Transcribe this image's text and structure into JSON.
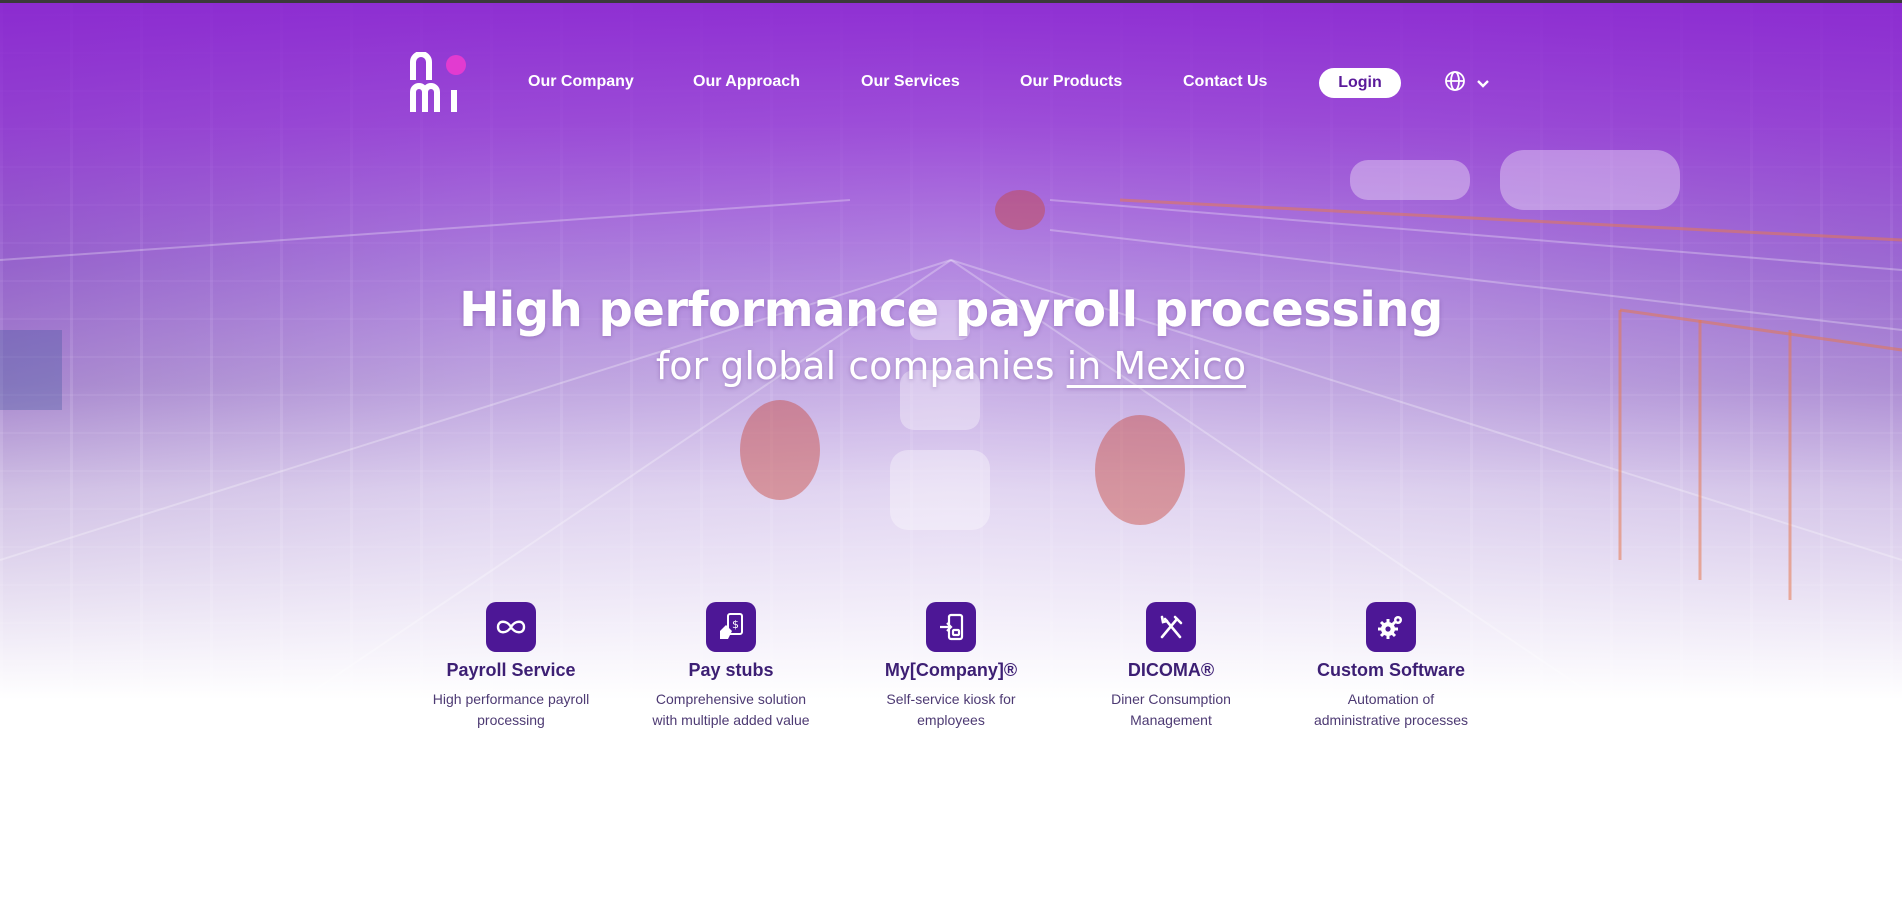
{
  "brand": {
    "logo_text": "nomi",
    "accent": "#e23bd0",
    "primary": "#4d1796"
  },
  "nav": {
    "items": [
      {
        "label": "Our Company"
      },
      {
        "label": "Our Approach"
      },
      {
        "label": "Our Services"
      },
      {
        "label": "Our Products"
      },
      {
        "label": "Contact Us"
      }
    ],
    "login_label": "Login",
    "language_icon": "globe-icon"
  },
  "hero": {
    "title": "High performance payroll processing",
    "subtitle_prefix": "for global companies ",
    "subtitle_highlight": "in Mexico"
  },
  "services": [
    {
      "icon": "infinity-icon",
      "title": "Payroll Service",
      "desc_line1": "High performance payroll",
      "desc_line2": "processing"
    },
    {
      "icon": "paystub-icon",
      "title": "Pay stubs",
      "desc_line1": "Comprehensive solution",
      "desc_line2": "with multiple added value"
    },
    {
      "icon": "kiosk-icon",
      "title": "My[Company]®",
      "desc_line1": "Self-service kiosk for",
      "desc_line2": "employees"
    },
    {
      "icon": "fork-knife-icon",
      "title": "DICOMA®",
      "desc_line1": "Diner Consumption",
      "desc_line2": "Management"
    },
    {
      "icon": "gears-icon",
      "title": "Custom Software",
      "desc_line1": "Automation of",
      "desc_line2": "administrative processes"
    }
  ]
}
